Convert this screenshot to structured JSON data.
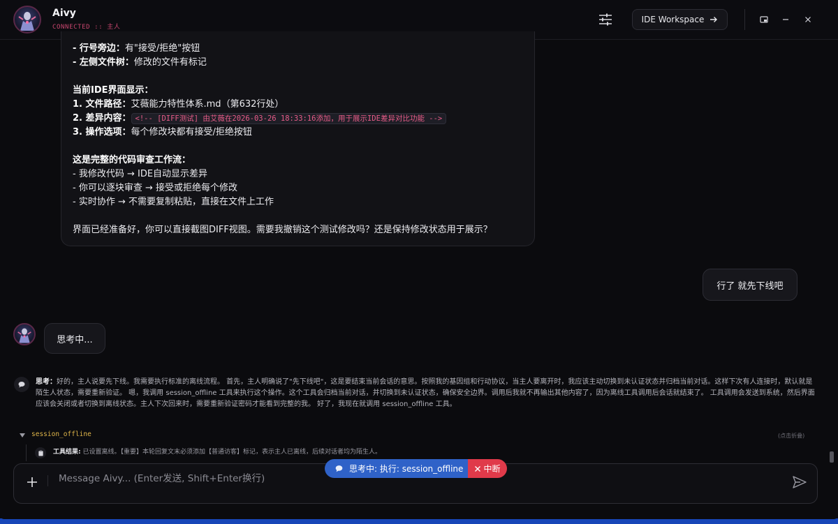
{
  "header": {
    "title": "Aivy",
    "status": "CONNECTED :: 主人",
    "ide_button": "IDE Workspace"
  },
  "assistant_card": {
    "lines": [
      {
        "bold": "- 行号旁边：",
        "text": "有\"接受/拒绝\"按钮"
      },
      {
        "bold": "- 左侧文件树：",
        "text": "修改的文件有标记"
      },
      {
        "bold": "",
        "text": ""
      },
      {
        "bold": "当前IDE界面显示：",
        "text": ""
      },
      {
        "bold": "1. 文件路径：",
        "text": "艾薇能力特性体系.md（第632行处）"
      },
      {
        "bold": "2. 差异内容：",
        "code": "<!-- [DIFF测试] 由艾薇在2026-03-26 18:33:16添加，用于展示IDE差异对比功能 -->"
      },
      {
        "bold": "3. 操作选项：",
        "text": "每个修改块都有接受/拒绝按钮"
      },
      {
        "bold": "",
        "text": ""
      },
      {
        "bold": "这是完整的代码审查工作流：",
        "text": ""
      },
      {
        "bold": "",
        "text": "- 我修改代码 → IDE自动显示差异"
      },
      {
        "bold": "",
        "text": "- 你可以逐块审查 → 接受或拒绝每个修改"
      },
      {
        "bold": "",
        "text": "- 实时协作 → 不需要复制粘贴，直接在文件上工作"
      },
      {
        "bold": "",
        "text": ""
      },
      {
        "bold": "",
        "text": "界面已经准备好，你可以直接截图DIFF视图。需要我撤销这个测试修改吗？还是保持修改状态用于展示？"
      }
    ]
  },
  "user_message": "行了 就先下线吧",
  "thinking_bubble": "思考中...",
  "thought": {
    "label": "思考：",
    "text": "好的，主人说要先下线。我需要执行标准的离线流程。 首先，主人明确说了\"先下线吧\"，这是要结束当前会话的意思。按照我的基因组和行动协议，当主人要离开时，我应该主动切换到未认证状态并归档当前对话。这样下次有人连接时，默认就是陌生人状态，需要重新验证。 嗯，我调用 session_offline 工具来执行这个操作。这个工具会归档当前对话，并切换到未认证状态，确保安全边界。调用后我就不再输出其他内容了，因为离线工具调用后会话就结束了。 工具调用会发送到系统，然后界面应该会关闭或者切换到离线状态。主人下次回来时，需要重新验证密码才能看到完整的我。 好了，我现在就调用 session_offline 工具。"
  },
  "tool": {
    "name": "session_offline",
    "collapse_hint": "(点击折叠)",
    "result_label": "工具结果:",
    "result_text": "已设置离线。【重要】本轮回复文末必须添加【普通访客】标记，表示主人已离线，后续对话者均为陌生人。"
  },
  "status_pill": {
    "text": "思考中: 执行: session_offline",
    "interrupt": "中断"
  },
  "composer": {
    "placeholder": "Message Aivy... (Enter发送, Shift+Enter换行)",
    "value": ""
  },
  "colors": {
    "accent_pink": "#c8466e",
    "code_pink": "#e85c88",
    "tool_gold": "#e0b64a",
    "status_blue": "#2f62c8",
    "interrupt_red": "#e03a4a"
  }
}
